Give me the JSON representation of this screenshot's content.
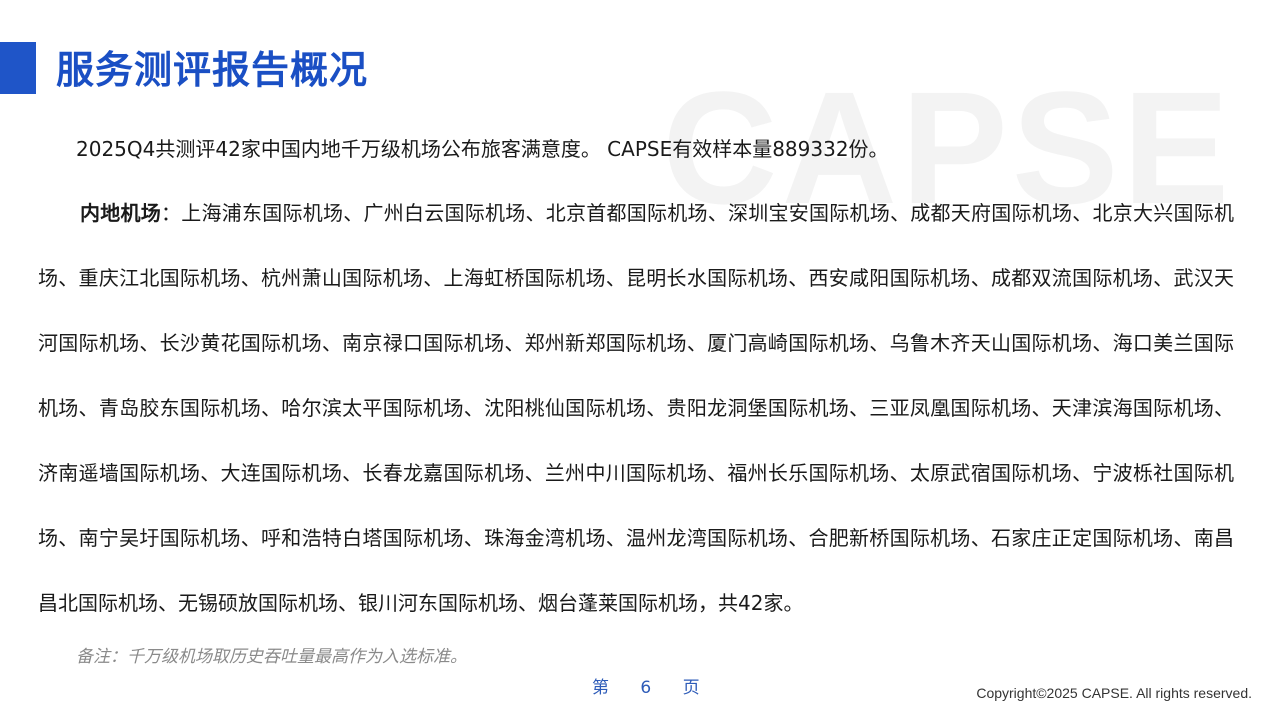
{
  "page": {
    "title": "服务测评报告概况",
    "watermark": "CAPSE",
    "intro": "2025Q4共测评42家中国内地千万级机场公布旅客满意度。 CAPSE有效样本量889332份。",
    "airports_label": "内地机场",
    "airports_separator": "：",
    "airports_text": "上海浦东国际机场、广州白云国际机场、北京首都国际机场、深圳宝安国际机场、成都天府国际机场、北京大兴国际机场、重庆江北国际机场、杭州萧山国际机场、上海虹桥国际机场、昆明长水国际机场、西安咸阳国际机场、成都双流国际机场、武汉天河国际机场、长沙黄花国际机场、南京禄口国际机场、郑州新郑国际机场、厦门高崎国际机场、乌鲁木齐天山国际机场、海口美兰国际机场、青岛胶东国际机场、哈尔滨太平国际机场、沈阳桃仙国际机场、贵阳龙洞堡国际机场、三亚凤凰国际机场、天津滨海国际机场、济南遥墙国际机场、大连国际机场、长春龙嘉国际机场、兰州中川国际机场、福州长乐国际机场、太原武宿国际机场、宁波栎社国际机场、南宁吴圩国际机场、呼和浩特白塔国际机场、珠海金湾机场、温州龙湾国际机场、合肥新桥国际机场、石家庄正定国际机场、南昌昌北国际机场、无锡硕放国际机场、银川河东国际机场、烟台蓬莱国际机场，共42家。",
    "note": "备注：千万级机场取历史吞吐量最高作为入选标准。",
    "page_number": "第 6 页",
    "copyright": "Copyright©2025 CAPSE. All rights reserved."
  },
  "colors": {
    "accent": "#1f55c8",
    "title": "#1a4fc4",
    "note": "#8a8a8a",
    "page_number": "#2d5bb8"
  }
}
